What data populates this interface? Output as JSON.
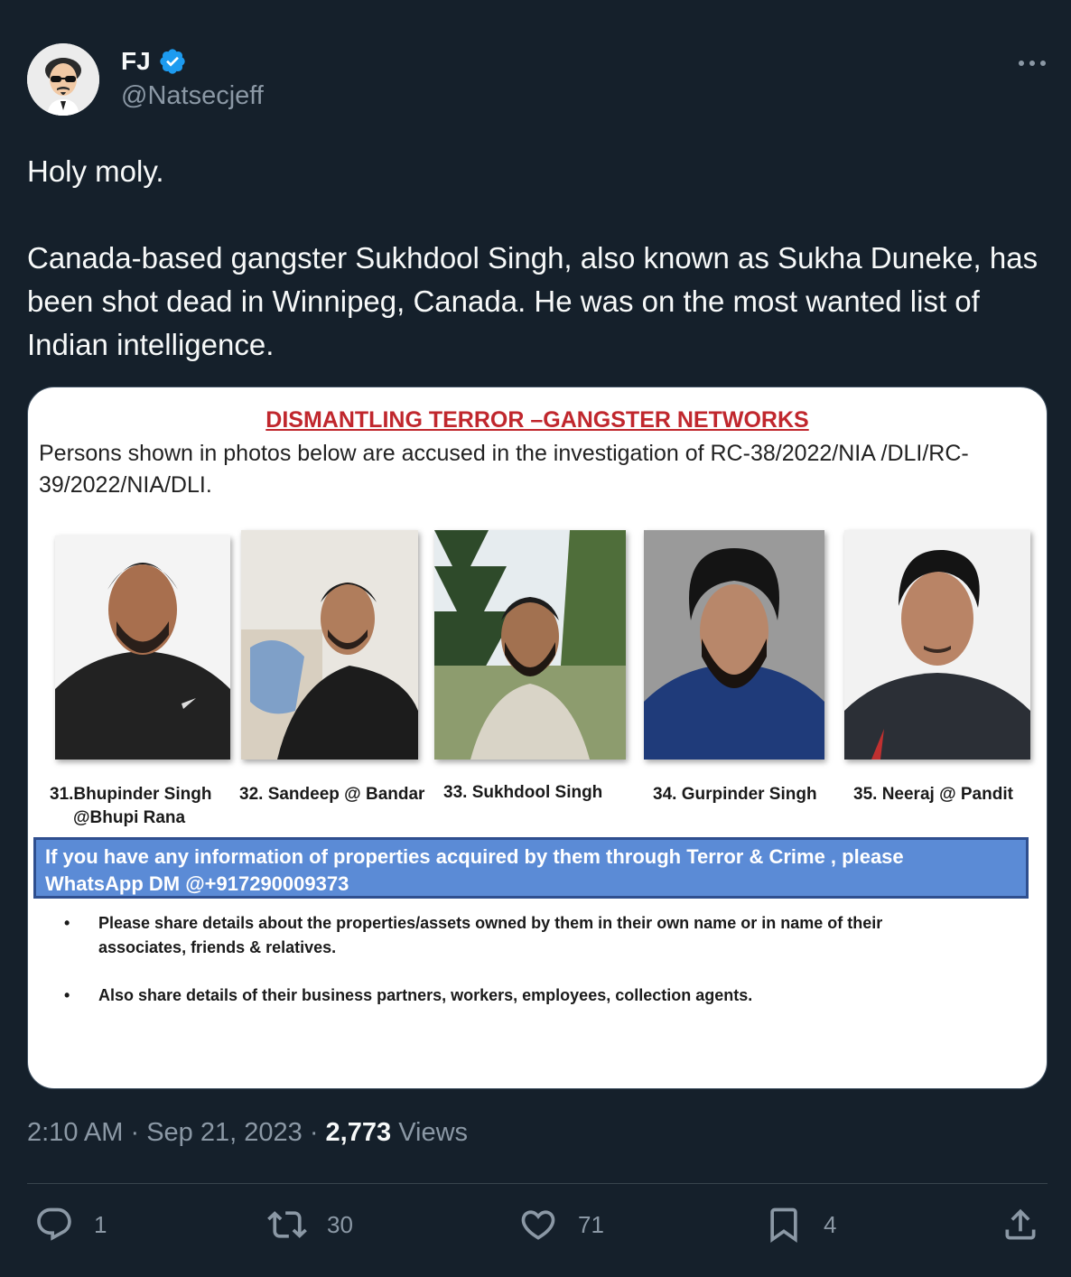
{
  "author": {
    "name": "FJ",
    "handle": "@Natsecjeff",
    "verified": true,
    "avatar_icon": "cartoon-man-sunglasses-avatar"
  },
  "tweet": {
    "line1": "Holy moly.",
    "line2": "Canada-based gangster Sukhdool Singh, also known as Sukha Duneke, has been shot dead in Winnipeg, Canada. He was on the most wanted list of Indian intelligence."
  },
  "poster": {
    "title": "DISMANTLING TERROR –GANGSTER NETWORKS",
    "subtitle_line1": "Persons shown in photos below are accused in the investigation of RC-38/2022/NIA   /DLI/RC-",
    "subtitle_line2": "39/2022/NIA/DLI.",
    "persons": [
      {
        "label1": "31.Bhupinder Singh",
        "label2": "@Bhupi Rana"
      },
      {
        "label1": "32. Sandeep @ Bandar",
        "label2": ""
      },
      {
        "label1": "33. Sukhdool Singh",
        "label2": ""
      },
      {
        "label1": "34. Gurpinder Singh",
        "label2": ""
      },
      {
        "label1": "35. Neeraj @ Pandit",
        "label2": ""
      }
    ],
    "info_line1": "If you have any information  of properties  acquired by them through Terror & Crime , please",
    "info_line2": "WhatsApp DM @+917290009373",
    "bullet1_line1": "Please share details  about the properties/assets owned by them in their own name or in name of their",
    "bullet1_line2": "associates, friends & relatives.",
    "bullet2": "Also share details of their business partners, workers, employees, collection agents."
  },
  "meta": {
    "time": "2:10 AM",
    "sep1": "·",
    "date": "Sep 21, 2023",
    "sep2": "·",
    "views_count": "2,773",
    "views_label": "Views"
  },
  "actions": {
    "replies": "1",
    "retweets": "30",
    "likes": "71",
    "bookmarks": "4"
  },
  "colors": {
    "background": "#15202b",
    "text": "#f7f9f9",
    "muted": "#8b98a5",
    "verified": "#1d9bf0",
    "poster_red": "#c0272d",
    "poster_blue": "#5b8bd6"
  }
}
